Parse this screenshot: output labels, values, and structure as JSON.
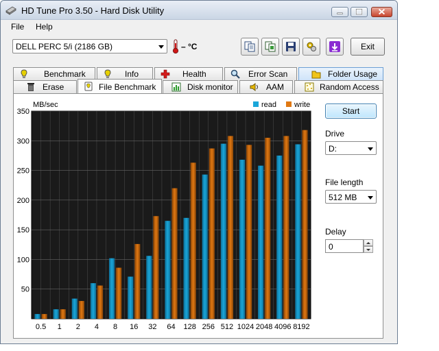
{
  "window": {
    "title": "HD Tune Pro 3.50 - Hard Disk Utility"
  },
  "menu": {
    "file": "File",
    "help": "Help"
  },
  "toolbar": {
    "drive": "DELL    PERC 5/i (2186 GB)",
    "temperature": "– °C",
    "exit_label": "Exit",
    "icons": [
      "copy-text-icon",
      "copy-screenshot-icon",
      "save-icon",
      "options-icon",
      "update-icon"
    ]
  },
  "tabs": {
    "top_row": [
      {
        "label": "Benchmark",
        "icon": "benchmark-icon"
      },
      {
        "label": "Info",
        "icon": "info-icon"
      },
      {
        "label": "Health",
        "icon": "health-icon"
      },
      {
        "label": "Error Scan",
        "icon": "error-scan-icon"
      },
      {
        "label": "Folder Usage",
        "icon": "folder-usage-icon"
      }
    ],
    "bottom_row": [
      {
        "label": "Erase",
        "icon": "erase-icon"
      },
      {
        "label": "File Benchmark",
        "icon": "file-benchmark-icon",
        "active": true
      },
      {
        "label": "Disk monitor",
        "icon": "disk-monitor-icon"
      },
      {
        "label": "AAM",
        "icon": "aam-icon"
      },
      {
        "label": "Random Access",
        "icon": "random-access-icon"
      }
    ]
  },
  "controls": {
    "start_label": "Start",
    "drive_label": "Drive",
    "drive_value": "D:",
    "file_length_label": "File length",
    "file_length_value": "512 MB",
    "delay_label": "Delay",
    "delay_value": "0"
  },
  "chart_data": {
    "type": "bar",
    "ylabel": "MB/sec",
    "ylim": [
      0,
      350
    ],
    "yticks": [
      50,
      100,
      150,
      200,
      250,
      300,
      350
    ],
    "categories": [
      "0.5",
      "1",
      "2",
      "4",
      "8",
      "16",
      "32",
      "64",
      "128",
      "256",
      "512",
      "1024",
      "2048",
      "4096",
      "8192"
    ],
    "series": [
      {
        "name": "read",
        "color": "#1aa6d9",
        "values": [
          8,
          16,
          34,
          60,
          102,
          71,
          106,
          165,
          170,
          243,
          295,
          268,
          258,
          275,
          294
        ]
      },
      {
        "name": "write",
        "color": "#e07812",
        "values": [
          8,
          16,
          30,
          56,
          86,
          126,
          173,
          220,
          263,
          287,
          308,
          293,
          305,
          308,
          318
        ]
      }
    ],
    "grid": true,
    "legend": "top-right",
    "background": "#1a1a1a",
    "grid_color": "#666666"
  }
}
